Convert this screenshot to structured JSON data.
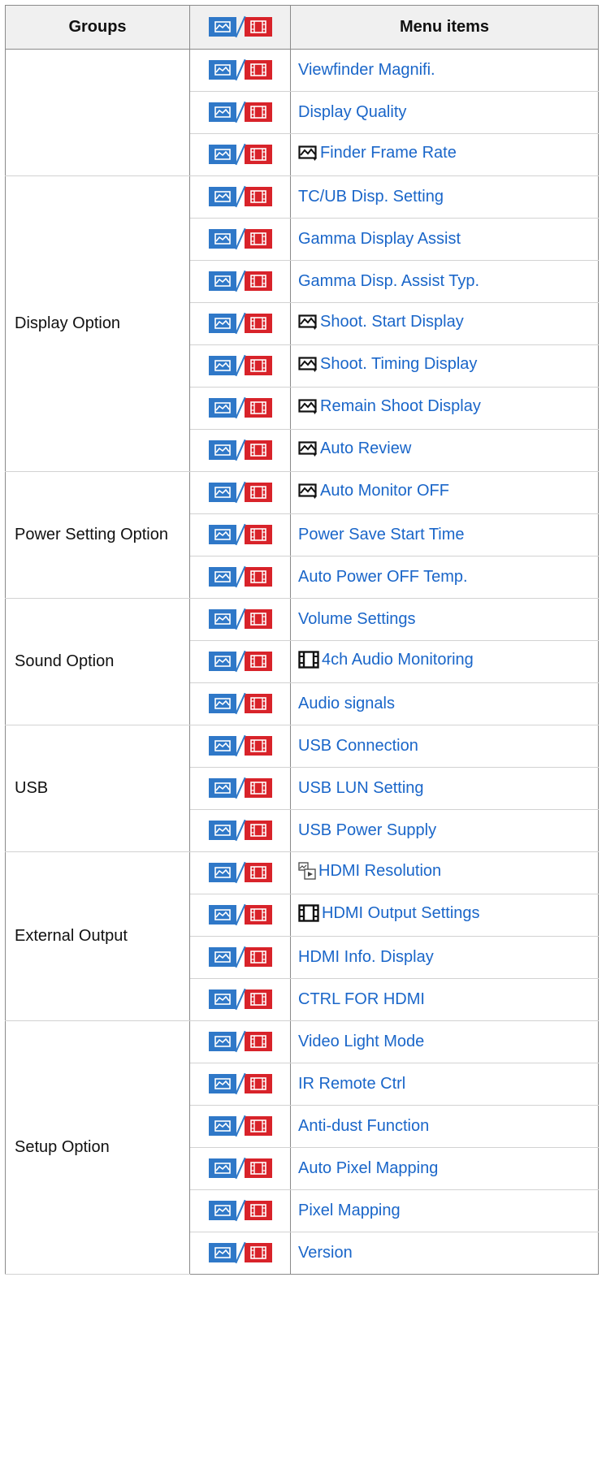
{
  "header": {
    "groups": "Groups",
    "menu_items": "Menu items"
  },
  "groups": [
    {
      "label": "",
      "items": [
        {
          "label": "Viewfinder Magnifi.",
          "icon": ""
        },
        {
          "label": "Display Quality",
          "icon": ""
        },
        {
          "label": "Finder Frame Rate",
          "icon": "still-image-icon"
        }
      ]
    },
    {
      "label": "Display Option",
      "items": [
        {
          "label": "TC/UB Disp. Setting",
          "icon": ""
        },
        {
          "label": "Gamma Display Assist",
          "icon": ""
        },
        {
          "label": "Gamma Disp. Assist Typ.",
          "icon": ""
        },
        {
          "label": "Shoot. Start Display",
          "icon": "still-image-icon"
        },
        {
          "label": "Shoot. Timing Display",
          "icon": "still-image-icon"
        },
        {
          "label": "Remain Shoot Display",
          "icon": "still-image-icon"
        },
        {
          "label": "Auto Review",
          "icon": "still-image-icon"
        }
      ]
    },
    {
      "label": "Power Setting Option",
      "items": [
        {
          "label": "Auto Monitor OFF",
          "icon": "still-image-icon"
        },
        {
          "label": "Power Save Start Time",
          "icon": ""
        },
        {
          "label": "Auto Power OFF Temp.",
          "icon": ""
        }
      ]
    },
    {
      "label": "Sound Option",
      "items": [
        {
          "label": "Volume Settings",
          "icon": ""
        },
        {
          "label": "4ch Audio Monitoring",
          "icon": "movie-icon"
        },
        {
          "label": "Audio signals",
          "icon": ""
        }
      ]
    },
    {
      "label": "USB",
      "items": [
        {
          "label": "USB Connection",
          "icon": ""
        },
        {
          "label": "USB LUN Setting",
          "icon": ""
        },
        {
          "label": "USB Power Supply",
          "icon": ""
        }
      ]
    },
    {
      "label": "External Output",
      "items": [
        {
          "label": "HDMI Resolution",
          "icon": "playback-icon"
        },
        {
          "label": "HDMI Output Settings",
          "icon": "movie-icon"
        },
        {
          "label": "HDMI Info. Display",
          "icon": ""
        },
        {
          "label": "CTRL FOR HDMI",
          "icon": ""
        }
      ]
    },
    {
      "label": "Setup Option",
      "items": [
        {
          "label": "Video Light Mode",
          "icon": ""
        },
        {
          "label": "IR Remote Ctrl",
          "icon": ""
        },
        {
          "label": "Anti-dust Function",
          "icon": ""
        },
        {
          "label": "Auto Pixel Mapping",
          "icon": ""
        },
        {
          "label": "Pixel Mapping",
          "icon": ""
        },
        {
          "label": "Version",
          "icon": ""
        }
      ]
    }
  ],
  "colors": {
    "still_badge": "#2f78c8",
    "movie_badge": "#d8232a",
    "link": "#1a66c9"
  }
}
